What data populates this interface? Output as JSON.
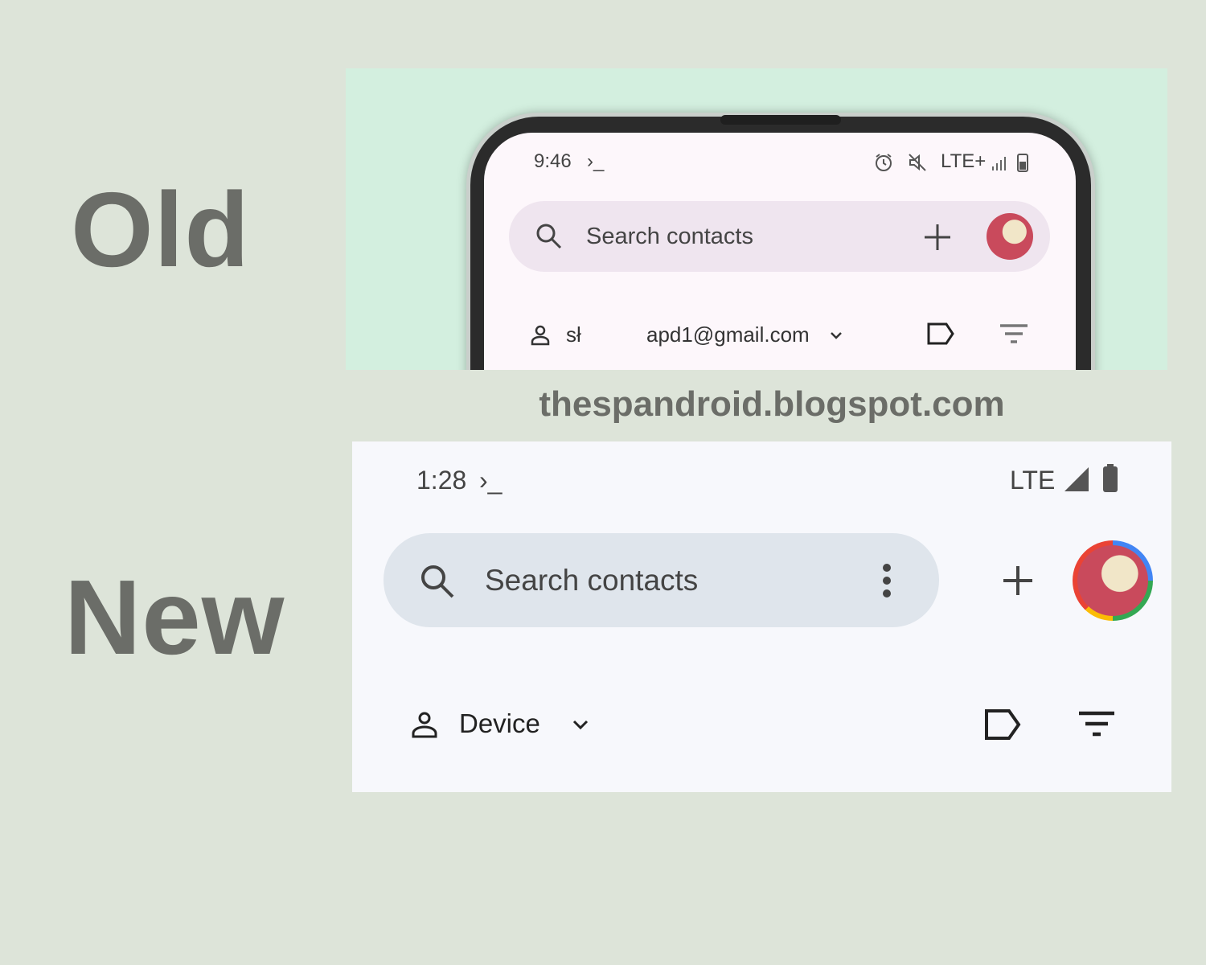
{
  "labels": {
    "old": "Old",
    "new": "New"
  },
  "watermark": "thespandroid.blogspot.com",
  "old": {
    "status": {
      "time": "9:46",
      "terminal": "›_",
      "network": "LTE+"
    },
    "search": {
      "placeholder": "Search contacts"
    },
    "account": {
      "prefix": "sł",
      "email": "apd1@gmail.com"
    }
  },
  "new": {
    "status": {
      "time": "1:28",
      "terminal": "›_",
      "network": "LTE"
    },
    "search": {
      "placeholder": "Search contacts"
    },
    "account": {
      "label": "Device"
    }
  },
  "colors": {
    "old_bg": "#d3efdf",
    "old_search": "#efe5ef",
    "new_search": "#dfe5ec",
    "page_bg": "#dde4d9"
  }
}
